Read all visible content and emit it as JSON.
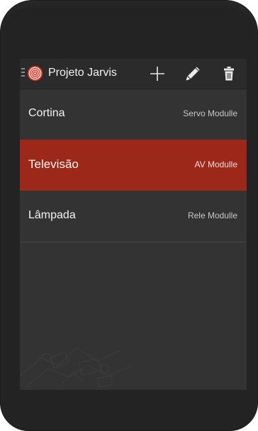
{
  "app": {
    "title": "Projeto Jarvis"
  },
  "toolbar": {
    "add_icon": "plus-icon",
    "edit_icon": "pencil-icon",
    "delete_icon": "trash-icon"
  },
  "devices": [
    {
      "name": "Cortina",
      "module": "Servo Modulle",
      "selected": false
    },
    {
      "name": "Televisão",
      "module": "AV Modulle",
      "selected": true
    },
    {
      "name": "Lâmpada",
      "module": "Rele Modulle",
      "selected": false
    }
  ],
  "colors": {
    "accent": "#9b2818",
    "logo_red": "#d93a2b",
    "background": "#333333",
    "action_bar": "#2b2b2b"
  }
}
